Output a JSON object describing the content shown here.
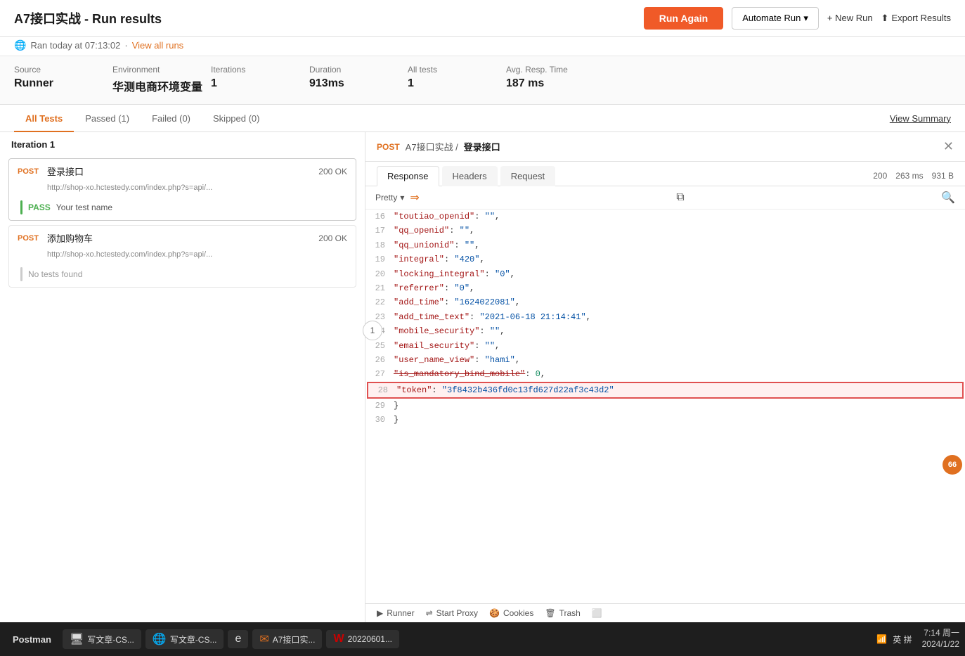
{
  "header": {
    "title": "A7接口实战 - Run results",
    "run_again_label": "Run Again",
    "automate_label": "Automate Run",
    "new_run_label": "+ New Run",
    "export_label": "Export Results"
  },
  "subheader": {
    "ran_text": "Ran today at 07:13:02",
    "separator": "·",
    "view_all_label": "View all runs"
  },
  "stats": [
    {
      "label": "Source",
      "value": "Runner"
    },
    {
      "label": "Environment",
      "value": "华测电商环境变量"
    },
    {
      "label": "Iterations",
      "value": "1"
    },
    {
      "label": "Duration",
      "value": "913ms"
    },
    {
      "label": "All tests",
      "value": "1"
    },
    {
      "label": "Avg. Resp. Time",
      "value": "187 ms"
    }
  ],
  "tabs": [
    {
      "label": "All Tests",
      "active": true
    },
    {
      "label": "Passed (1)",
      "active": false
    },
    {
      "label": "Failed (0)",
      "active": false
    },
    {
      "label": "Skipped (0)",
      "active": false
    }
  ],
  "view_summary_label": "View Summary",
  "iteration_label": "Iteration 1",
  "iteration_number": "1",
  "requests": [
    {
      "method": "POST",
      "name": "登录接口",
      "url": "http://shop-xo.hctestedу.com/index.php?s=api/...",
      "status": "200 OK",
      "tests": [
        {
          "pass": true,
          "label": "PASS",
          "name": "Your test name"
        }
      ]
    },
    {
      "method": "POST",
      "name": "添加购物车",
      "url": "http://shop-xo.hctestedу.com/index.php?s=api/...",
      "status": "200 OK",
      "tests": [],
      "no_tests": "No tests found"
    }
  ],
  "right_panel": {
    "method": "POST",
    "breadcrumb": "A7接口实战 / 登录接口",
    "resp_tabs": [
      "Response",
      "Headers",
      "Request"
    ],
    "active_resp_tab": "Response",
    "status_code": "200",
    "resp_time": "263 ms",
    "resp_size": "931 B",
    "toolbar": {
      "pretty_label": "Pretty",
      "chevron": "▾"
    },
    "json_lines": [
      {
        "num": 16,
        "content": "    \"toutiao_openid\": \"\","
      },
      {
        "num": 17,
        "content": "    \"qq_openid\": \"\","
      },
      {
        "num": 18,
        "content": "    \"qq_unionid\": \"\","
      },
      {
        "num": 19,
        "content": "    \"integral\": \"420\","
      },
      {
        "num": 20,
        "content": "    \"locking_integral\": \"0\","
      },
      {
        "num": 21,
        "content": "    \"referrer\": \"0\","
      },
      {
        "num": 22,
        "content": "    \"add_time\": \"1624022081\","
      },
      {
        "num": 23,
        "content": "    \"add_time_text\": \"2021-06-18 21:14:41\","
      },
      {
        "num": 24,
        "content": "    \"mobile_security\": \"\","
      },
      {
        "num": 25,
        "content": "    \"email_security\": \"\","
      },
      {
        "num": 26,
        "content": "    \"user_name_view\": \"hami\","
      },
      {
        "num": 27,
        "content": "    \"is_mandatory_bind_mobile\": 0,"
      },
      {
        "num": 28,
        "content": "    \"token\": \"3f8432b436fd0c13fd627d22af3c43d2\"",
        "highlighted": true
      },
      {
        "num": 29,
        "content": "}"
      },
      {
        "num": 30,
        "content": "}"
      }
    ]
  },
  "footer": {
    "runner_label": "Runner",
    "proxy_label": "Start Proxy",
    "cookies_label": "Cookies",
    "trash_label": "Trash"
  },
  "taskbar": {
    "postman_label": "Postman",
    "items": [
      "写文章-CS...",
      "A7接口实...",
      "20220601...",
      "英 拼"
    ],
    "clock": "7:14 周一",
    "date": "2024/1/22"
  },
  "orange_badge": "66"
}
